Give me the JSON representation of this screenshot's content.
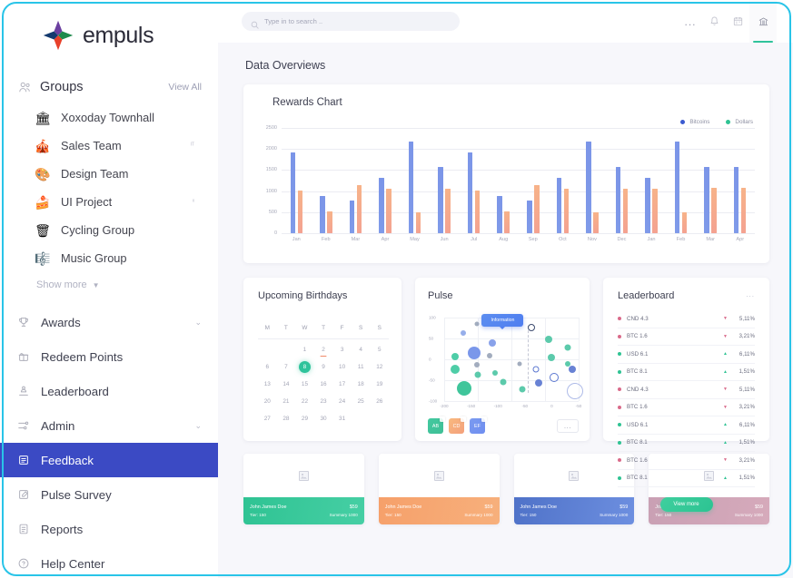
{
  "brand": {
    "name": "empuls"
  },
  "search": {
    "placeholder": "Type in to search .."
  },
  "topbar": {
    "dots_label": "...",
    "icons": [
      "bell-icon",
      "calendar-icon",
      "bank-icon"
    ]
  },
  "sidebar": {
    "groups_header": {
      "title": "Groups",
      "view_all": "View All"
    },
    "groups": [
      {
        "label": "Xoxoday Townhall",
        "emoji": "🏛",
        "badge": ""
      },
      {
        "label": "Sales Team",
        "emoji": "🎪",
        "badge": "ᴵᵀ"
      },
      {
        "label": "Design Team",
        "emoji": "🎨",
        "badge": ""
      },
      {
        "label": "UI Project",
        "emoji": "🍰",
        "badge": "ˣ"
      },
      {
        "label": "Cycling Group",
        "emoji": "🗑",
        "badge": ""
      },
      {
        "label": "Music Group",
        "emoji": "🎼",
        "badge": ""
      }
    ],
    "show_more": "Show more",
    "nav": [
      {
        "label": "Awards",
        "icon": "trophy-icon",
        "chevron": true,
        "active": false
      },
      {
        "label": "Redeem Points",
        "icon": "gift-icon",
        "chevron": false,
        "active": false
      },
      {
        "label": "Leaderboard",
        "icon": "podium-icon",
        "chevron": false,
        "active": false
      },
      {
        "label": "Admin",
        "icon": "sliders-icon",
        "chevron": true,
        "active": false
      },
      {
        "label": "Feedback",
        "icon": "feedback-icon",
        "chevron": false,
        "active": true
      },
      {
        "label": "Pulse Survey",
        "icon": "survey-icon",
        "chevron": false,
        "active": false
      },
      {
        "label": "Reports",
        "icon": "report-icon",
        "chevron": false,
        "active": false
      },
      {
        "label": "Help Center",
        "icon": "help-icon",
        "chevron": false,
        "active": false
      }
    ]
  },
  "page": {
    "title": "Data Overviews"
  },
  "chart_data": {
    "type": "bar",
    "title": "Rewards Chart",
    "xlabel": "",
    "ylabel": "",
    "ylim": [
      0,
      2500
    ],
    "yticks": [
      0,
      500,
      1000,
      1500,
      2000,
      2500
    ],
    "grid": true,
    "legend_position": "top-right",
    "categories": [
      "Jan",
      "Feb",
      "Mar",
      "Apr",
      "May",
      "Jun",
      "Jul",
      "Aug",
      "Sep",
      "Oct",
      "Nov",
      "Dec",
      "Jan",
      "Feb",
      "Mar",
      "Apr"
    ],
    "series": [
      {
        "name": "Bitcoins",
        "color": "#7b95e8",
        "values": [
          1910,
          890,
          780,
          1320,
          2170,
          1580,
          1910,
          890,
          780,
          1320,
          2170,
          1580,
          1320,
          2170,
          1580,
          1580
        ]
      },
      {
        "name": "Dollars",
        "color": "#f4a291",
        "values": [
          1010,
          510,
          1150,
          1060,
          490,
          1060,
          1010,
          510,
          1150,
          1060,
          490,
          1060,
          1060,
          490,
          1070,
          1070
        ]
      }
    ]
  },
  "birthdays": {
    "title": "Upcoming Birthdays",
    "weekdays": [
      "M",
      "T",
      "W",
      "T",
      "F",
      "S",
      "S"
    ],
    "weeks": [
      [
        "",
        "",
        "1",
        "2",
        "3",
        "4",
        "5"
      ],
      [
        "6",
        "7",
        "8",
        "9",
        "10",
        "11",
        "12"
      ],
      [
        "13",
        "14",
        "15",
        "16",
        "17",
        "18",
        "19"
      ],
      [
        "20",
        "21",
        "22",
        "23",
        "24",
        "25",
        "26"
      ],
      [
        "27",
        "28",
        "29",
        "30",
        "31",
        "",
        ""
      ]
    ],
    "selected": "8",
    "marked": "2"
  },
  "pulse": {
    "title": "Pulse",
    "tooltip": "Information",
    "yticks": [
      "100",
      "50",
      "0",
      "-50",
      "-100"
    ],
    "xticks": [
      "-200",
      "-150",
      "-100",
      "-50",
      "0",
      "-50"
    ],
    "badges": [
      {
        "label": "AB",
        "color": "green"
      },
      {
        "label": "CD",
        "color": "orange"
      },
      {
        "label": "EF",
        "color": "blue"
      }
    ],
    "more_label": "...",
    "points": [
      {
        "x": 8,
        "y": 47,
        "r": 4,
        "c": "#3fc9a0",
        "f": "solid"
      },
      {
        "x": 8,
        "y": 62,
        "r": 5,
        "c": "#3fc9a0",
        "f": "solid"
      },
      {
        "x": 15,
        "y": 85,
        "r": 8,
        "c": "#2fc093",
        "f": "solid"
      },
      {
        "x": 14,
        "y": 18,
        "r": 3,
        "c": "#8da7e8",
        "f": "solid"
      },
      {
        "x": 22,
        "y": 42,
        "r": 7,
        "c": "#6f8ee8",
        "f": "solid"
      },
      {
        "x": 24,
        "y": 8,
        "r": 2.5,
        "c": "#9aa5b8",
        "f": "solid"
      },
      {
        "x": 24,
        "y": 57,
        "r": 3,
        "c": "#9aa5b8",
        "f": "solid"
      },
      {
        "x": 25,
        "y": 69,
        "r": 3.5,
        "c": "#4ec5a4",
        "f": "solid"
      },
      {
        "x": 34,
        "y": 46,
        "r": 3,
        "c": "#9aa5b8",
        "f": "solid"
      },
      {
        "x": 36,
        "y": 30,
        "r": 4,
        "c": "#7f9ae8",
        "f": "solid"
      },
      {
        "x": 38,
        "y": 66,
        "r": 3,
        "c": "#4ec5a4",
        "f": "solid"
      },
      {
        "x": 44,
        "y": 77,
        "r": 3.5,
        "c": "#4ec5a4",
        "f": "solid"
      },
      {
        "x": 56,
        "y": 55,
        "r": 2.5,
        "c": "#9aa5b8",
        "f": "solid"
      },
      {
        "x": 58,
        "y": 86,
        "r": 3.5,
        "c": "#4ec5a4",
        "f": "solid"
      },
      {
        "x": 65,
        "y": 12,
        "r": 4,
        "c": "#3c4a6e",
        "f": "ring"
      },
      {
        "x": 68,
        "y": 62,
        "r": 3.5,
        "c": "#5b77d0",
        "f": "ring"
      },
      {
        "x": 70,
        "y": 78,
        "r": 4,
        "c": "#5b77d0",
        "f": "solid"
      },
      {
        "x": 78,
        "y": 26,
        "r": 4,
        "c": "#4ec5a4",
        "f": "solid"
      },
      {
        "x": 80,
        "y": 48,
        "r": 4,
        "c": "#4ec5a4",
        "f": "solid"
      },
      {
        "x": 82,
        "y": 72,
        "r": 5,
        "c": "#5b77d0",
        "f": "ring"
      },
      {
        "x": 92,
        "y": 36,
        "r": 3.5,
        "c": "#4ec5a4",
        "f": "solid"
      },
      {
        "x": 92,
        "y": 55,
        "r": 3,
        "c": "#4ec5a4",
        "f": "solid"
      },
      {
        "x": 95,
        "y": 62,
        "r": 4,
        "c": "#5b77d0",
        "f": "solid"
      },
      {
        "x": 97,
        "y": 88,
        "r": 9,
        "c": "#aebbe8",
        "f": "ring"
      }
    ]
  },
  "leaderboard": {
    "title": "Leaderboard",
    "dots_label": "...",
    "view_more": "View more",
    "rows": [
      {
        "name": "CND 4.3",
        "pct": "5,11%",
        "dir": "down",
        "color": "#d96a8a"
      },
      {
        "name": "BTC 1.6",
        "pct": "3,21%",
        "dir": "down",
        "color": "#d96a8a"
      },
      {
        "name": "USD 6.1",
        "pct": "6,11%",
        "dir": "up",
        "color": "#2fc393"
      },
      {
        "name": "BTC 8.1",
        "pct": "1,51%",
        "dir": "up",
        "color": "#2fc393"
      },
      {
        "name": "CND 4.3",
        "pct": "5,11%",
        "dir": "down",
        "color": "#d96a8a"
      },
      {
        "name": "BTC 1.6",
        "pct": "3,21%",
        "dir": "down",
        "color": "#d96a8a"
      },
      {
        "name": "USD 6.1",
        "pct": "6,11%",
        "dir": "up",
        "color": "#2fc393"
      },
      {
        "name": "BTC 8.1",
        "pct": "1,51%",
        "dir": "up",
        "color": "#2fc393"
      },
      {
        "name": "BTC 1.6",
        "pct": "3,21%",
        "dir": "down",
        "color": "#d96a8a"
      },
      {
        "name": "BTC 8.1",
        "pct": "1,51%",
        "dir": "up",
        "color": "#2fc393"
      }
    ]
  },
  "mini_cards": [
    {
      "name": "John James Doe",
      "amount": "$59",
      "tier": "Tier: 150",
      "summary": "Summary  1000",
      "theme": "f-green"
    },
    {
      "name": "John James Doe",
      "amount": "$59",
      "tier": "Tier: 150",
      "summary": "Summary  1000",
      "theme": "f-orange"
    },
    {
      "name": "John James Doe",
      "amount": "$59",
      "tier": "Tier: 150",
      "summary": "Summary  1000",
      "theme": "f-blue"
    },
    {
      "name": "John James Doe",
      "amount": "$59",
      "tier": "Tier: 150",
      "summary": "Summary  1000",
      "theme": "f-pink"
    }
  ]
}
